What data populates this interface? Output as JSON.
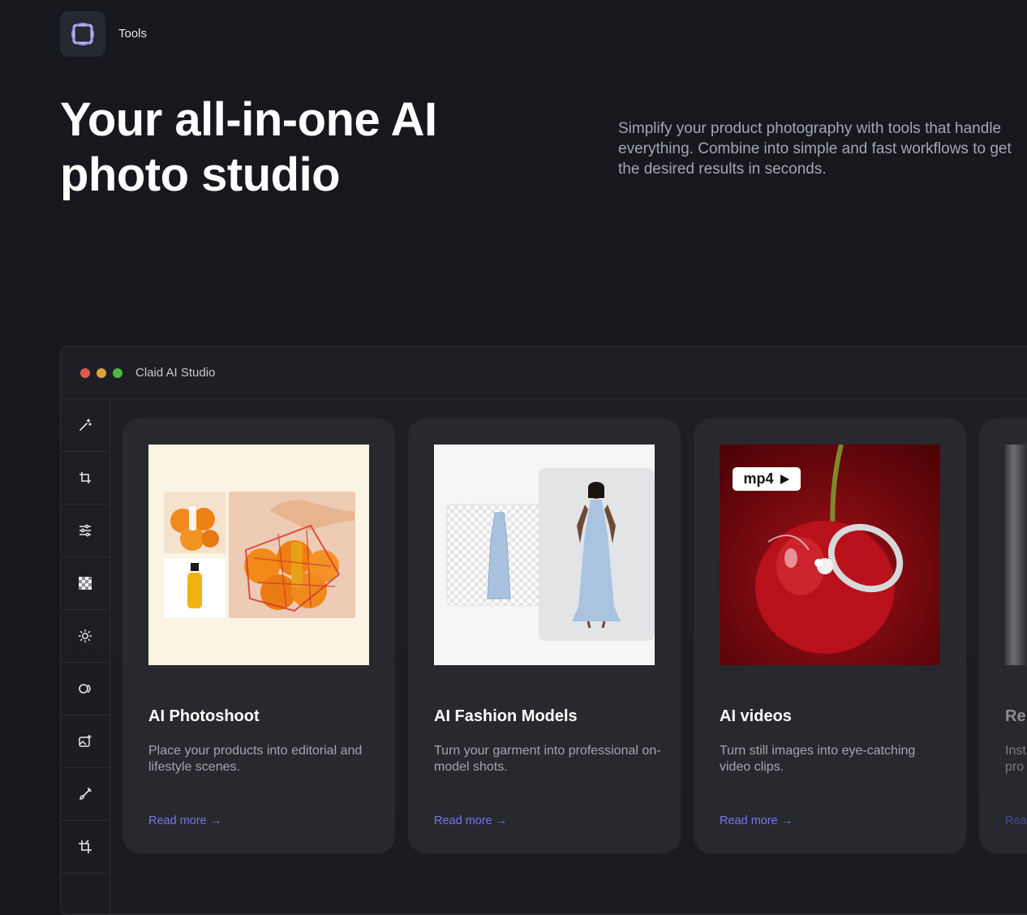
{
  "header": {
    "nav_label": "Tools",
    "logo_icon": "claid-logo-icon"
  },
  "hero": {
    "title": "Your all-in-one AI photo studio",
    "description": "Simplify your product photography with tools that handle everything. Combine into simple and fast workflows to get the desired results in seconds."
  },
  "studio": {
    "window_title": "Claid AI Studio",
    "sidebar_icons": [
      "magic-wand-icon",
      "crop-icon",
      "adjustments-icon",
      "transparency-icon",
      "brightness-icon",
      "toggle-icon",
      "image-edit-icon",
      "brush-icon",
      "resize-crop-icon"
    ]
  },
  "cards": [
    {
      "title": "AI Photoshoot",
      "description": "Place your products into editorial and lifestyle scenes.",
      "link": "Read more",
      "arrow": "→"
    },
    {
      "title": "AI Fashion Models",
      "description": "Turn your garment into professional on-model shots.",
      "link": "Read more",
      "arrow": "→"
    },
    {
      "title": "AI videos",
      "description": "Turn still images into eye-catching video clips.",
      "link": "Read more",
      "arrow": "→",
      "badge": "mp4"
    },
    {
      "title": "Re",
      "description": "Inst pro",
      "link": "Rea"
    }
  ],
  "colors": {
    "background": "#16181d",
    "card": "#28292e",
    "accent": "#7b72f0"
  }
}
